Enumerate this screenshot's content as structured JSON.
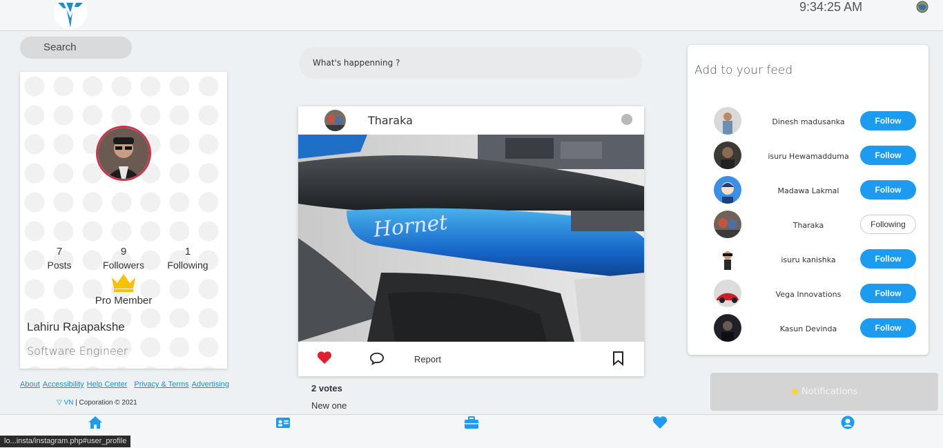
{
  "header": {
    "clock": "9:34:25 AM"
  },
  "search": {
    "placeholder": "Search"
  },
  "profile": {
    "stats": [
      {
        "value": "7",
        "label": "Posts"
      },
      {
        "value": "9",
        "label": "Followers"
      },
      {
        "value": "1",
        "label": "Following"
      }
    ],
    "membership": "Pro Member",
    "name": "Lahiru Rajapakshe",
    "title": "Software Engineer"
  },
  "footer": {
    "links": [
      "About",
      "Accessibility",
      "Help Center",
      "Privacy & Terms",
      "Advertising"
    ],
    "brand": "VN",
    "copyright": "| Coporation © 2021"
  },
  "composer": {
    "placeholder": "What's happenning ?"
  },
  "post": {
    "author": "Tharaka",
    "report_label": "Report",
    "votes": "2 votes",
    "caption": "New one"
  },
  "feed": {
    "title": "Add to your feed",
    "suggestions": [
      {
        "name": "Dinesh madusanka",
        "button": "Follow"
      },
      {
        "name": "isuru Hewamadduma",
        "button": "Follow"
      },
      {
        "name": "Madawa Lakmal",
        "button": "Follow"
      },
      {
        "name": "Tharaka",
        "button": "Following"
      },
      {
        "name": "isuru kanishka",
        "button": "Follow"
      },
      {
        "name": "Vega Innovations",
        "button": "Follow"
      },
      {
        "name": "Kasun Devinda",
        "button": "Follow"
      }
    ]
  },
  "notifications": {
    "label": "Notifications"
  },
  "bottom_nav": [
    "home-icon",
    "id-card-icon",
    "briefcase-icon",
    "heart-icon",
    "user-circle-icon"
  ],
  "status_bar": {
    "url": "lo...insta/instagram.php#user_profile"
  },
  "colors": {
    "accent": "#1d9bf0",
    "link": "#1e8fc0",
    "like": "#e0202e",
    "avatar_ring": "#c8354e"
  }
}
